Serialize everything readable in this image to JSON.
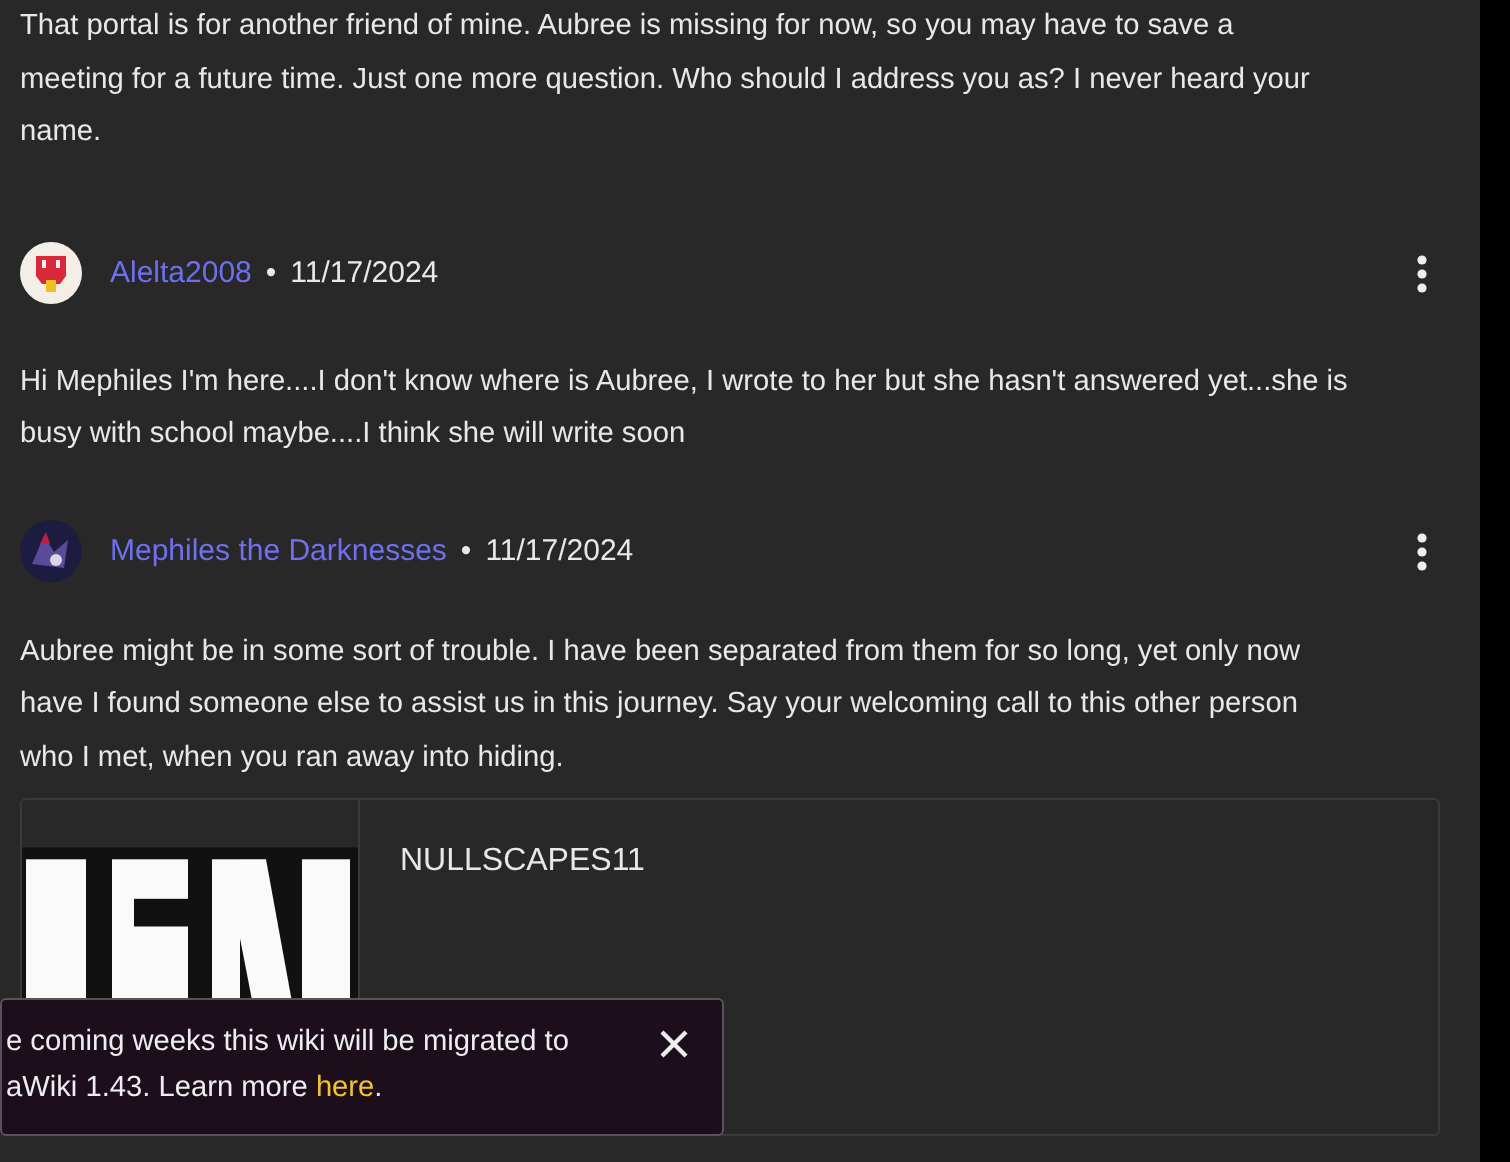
{
  "intro": {
    "lines": [
      "That portal is for another friend of mine. Aubree is missing for now, so you may have to save a",
      "meeting for a future time. Just one more question. Who should I address you as? I never heard your",
      "name."
    ]
  },
  "comments": [
    {
      "author": "Alelta2008",
      "separator": "•",
      "date": "11/17/2024",
      "avatar": {
        "kind": "bell"
      },
      "lines": [
        "Hi Mephiles I'm here....I don't know where is Aubree, I wrote to her but she hasn't answered yet...she is",
        "busy with school maybe....I think she will write soon"
      ]
    },
    {
      "author": "Mephiles the Darknesses",
      "separator": "•",
      "date": "11/17/2024",
      "avatar": {
        "kind": "dark"
      },
      "lines": [
        "Aubree might be in some sort of trouble. I have been separated from them for so long, yet only now",
        "have I found someone else to assist us in this journey. Say your welcoming call to this other person",
        "who I met, when you ran away into hiding."
      ],
      "embed": {
        "title": "NULLSCAPES11"
      }
    }
  ],
  "toast": {
    "lines": [
      "e coming weeks this wiki will be migrated to",
      "aWiki 1.43. Learn more"
    ],
    "link": "here",
    "after": "."
  }
}
